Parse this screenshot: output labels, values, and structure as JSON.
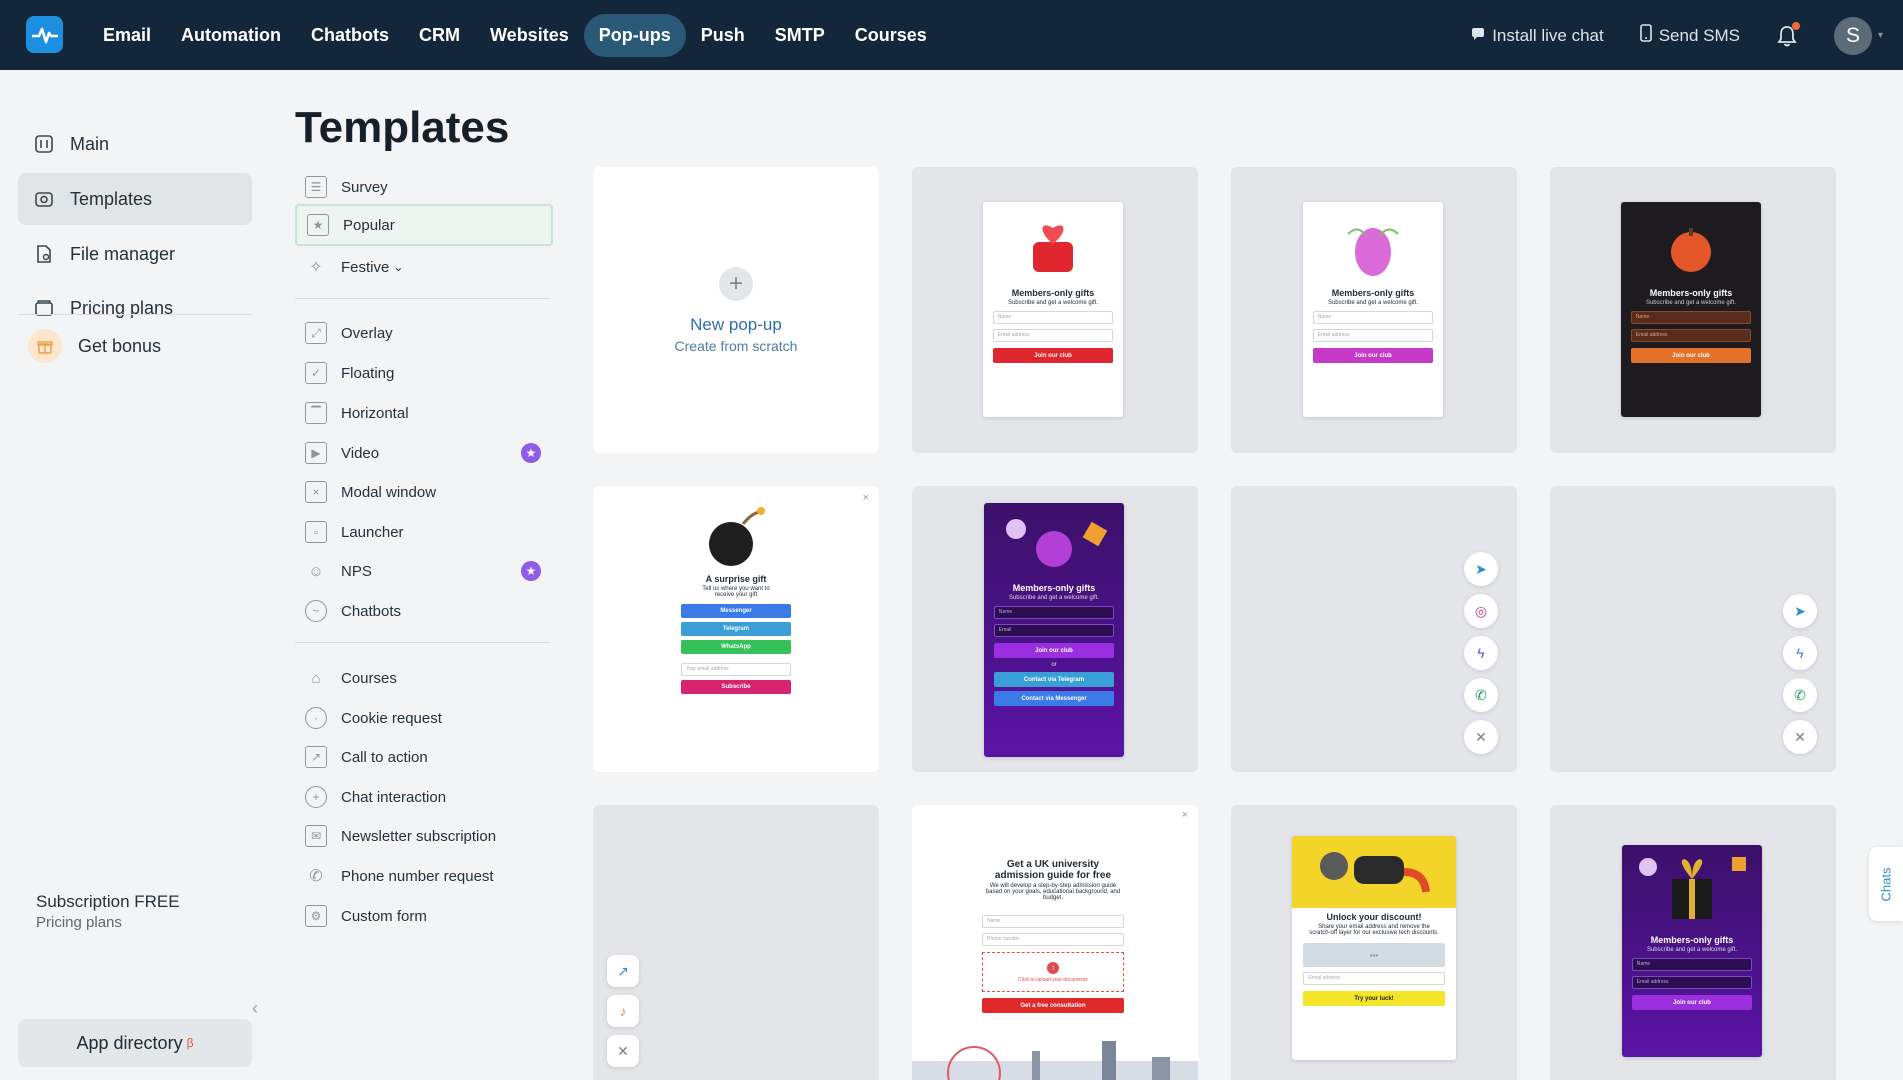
{
  "topnav": {
    "items": [
      "Email",
      "Automation",
      "Chatbots",
      "CRM",
      "Websites",
      "Pop-ups",
      "Push",
      "SMTP",
      "Courses"
    ],
    "active": "Pop-ups",
    "install_live_chat": "Install live chat",
    "send_sms": "Send SMS",
    "avatar_letter": "S"
  },
  "sidebar": {
    "items": [
      "Main",
      "Templates",
      "File manager",
      "Pricing plans"
    ],
    "bonus": "Get bonus",
    "subscription": "Subscription FREE",
    "pricing_plans": "Pricing plans",
    "app_directory": "App directory",
    "app_directory_badge": "β"
  },
  "page": {
    "title": "Templates"
  },
  "categories": {
    "group1": [
      "Survey",
      "Popular",
      "Festive"
    ],
    "group2": [
      "Overlay",
      "Floating",
      "Horizontal",
      "Video",
      "Modal window",
      "Launcher",
      "NPS",
      "Chatbots"
    ],
    "group3": [
      "Courses",
      "Cookie request",
      "Call to action",
      "Chat interaction",
      "Newsletter subscription",
      "Phone number request",
      "Custom form"
    ],
    "active": "Popular"
  },
  "new_popup": {
    "title": "New pop-up",
    "subtitle": "Create from scratch"
  },
  "previews": {
    "members_title": "Members-only gifts",
    "members_sub": "Subscribe and get a welcome gift.",
    "name": "Name",
    "email_address": "Email address",
    "email": "Email",
    "join": "Join our club",
    "or": "or",
    "via_telegram": "Contact via Telegram",
    "via_messenger": "Contact via Messenger",
    "surprise_title": "A surprise gift",
    "surprise_sub": "Tell us where you want to receive your gift",
    "messenger": "Messenger",
    "telegram": "Telegram",
    "whatsapp": "WhatsApp",
    "your_email": "Your email address",
    "subscribe": "Subscribe",
    "uk_title": "Get a UK university admission guide for free",
    "uk_sub": "We will develop a step-by-step admission guide based on your goals, educational background, and budget.",
    "phone": "Phone number",
    "upload": "Click to upload your documents",
    "consult": "Get a free consultation",
    "discount_title": "Unlock your discount!",
    "discount_sub": "Share your email address and remove the scratch-off layer for our exclusive tech discounts.",
    "luck": "Try your luck!"
  },
  "chats_tab": "Chats",
  "colors": {
    "nav_bg": "#14273a",
    "accent": "#2a5977",
    "purple": "#8f5ce8"
  }
}
